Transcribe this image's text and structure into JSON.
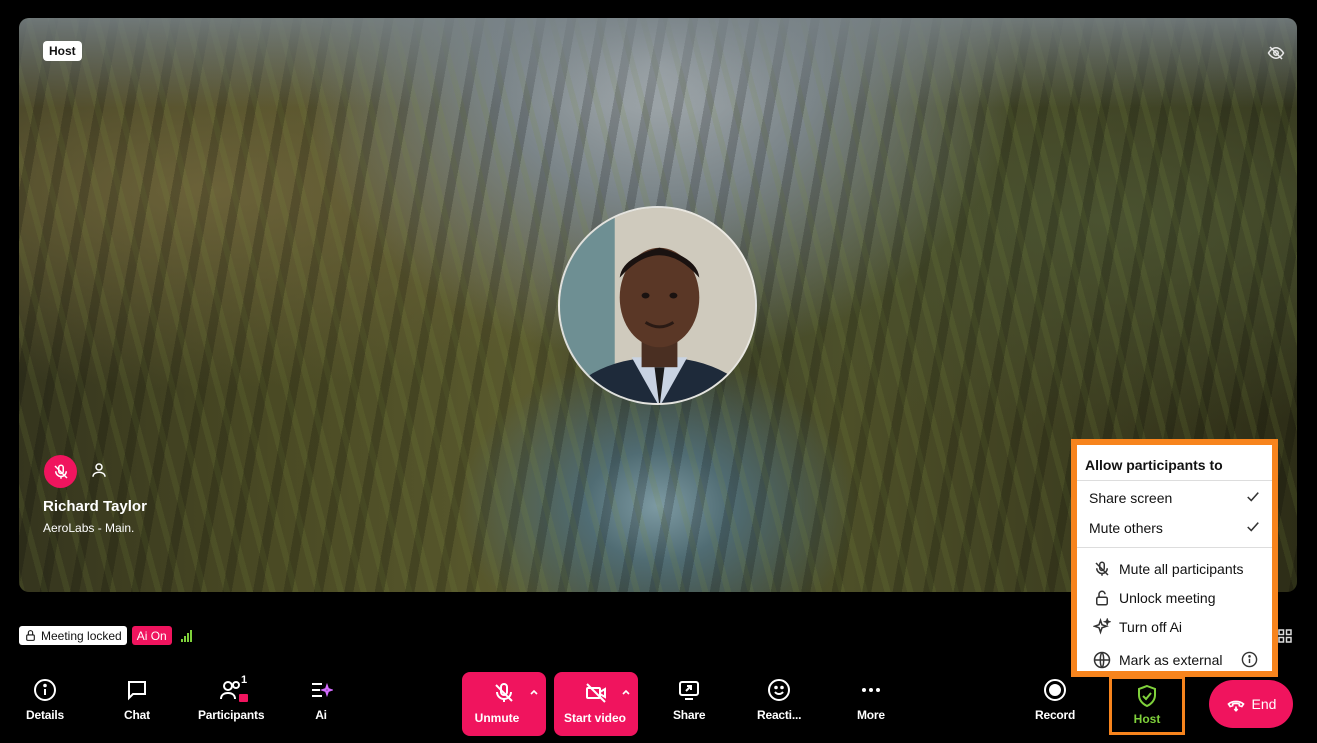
{
  "stage": {
    "host_tag": "Host",
    "participant": {
      "name": "Richard Taylor",
      "org": "AeroLabs - Main."
    }
  },
  "status": {
    "meeting_locked": "Meeting locked",
    "ai_on": "Ai On"
  },
  "toolbar": {
    "details": "Details",
    "chat": "Chat",
    "participants": "Participants",
    "participants_count": "1",
    "ai": "Ai",
    "unmute": "Unmute",
    "start_video": "Start video",
    "share": "Share",
    "reactions": "Reacti...",
    "more": "More",
    "record": "Record",
    "host": "Host",
    "end": "End"
  },
  "host_menu": {
    "title": "Allow participants to",
    "toggles": [
      {
        "label": "Share screen",
        "checked": true
      },
      {
        "label": "Mute others",
        "checked": true
      }
    ],
    "actions": [
      {
        "label": "Mute all participants",
        "icon": "mic-off-icon"
      },
      {
        "label": "Unlock meeting",
        "icon": "unlock-icon"
      },
      {
        "label": "Turn off Ai",
        "icon": "sparkle-icon"
      },
      {
        "label": "Mark as external",
        "icon": "globe-icon"
      }
    ]
  },
  "colors": {
    "accent_pink": "#f0145e",
    "highlight_orange": "#f7841d",
    "host_green": "#7fd13b"
  }
}
